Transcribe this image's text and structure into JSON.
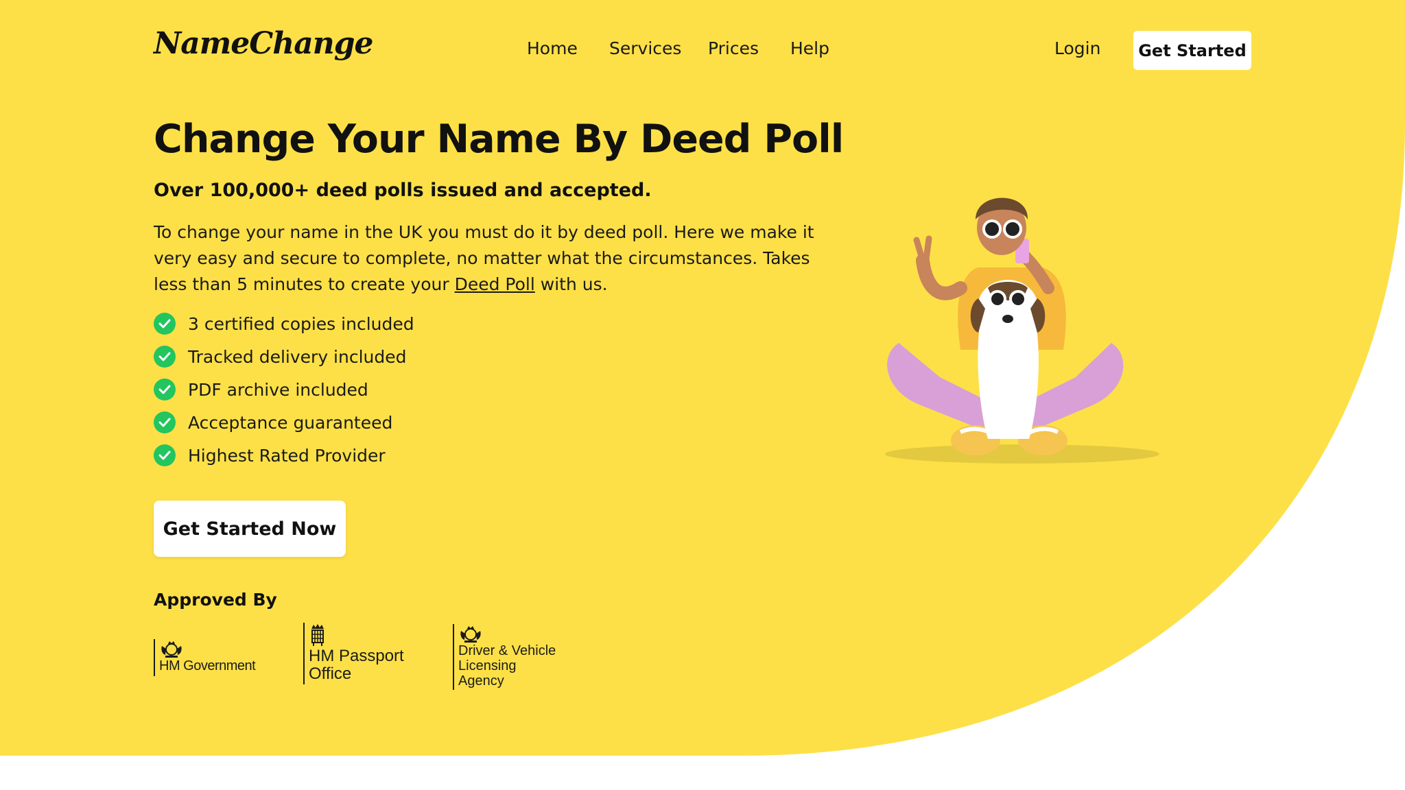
{
  "brand": {
    "logo_text": "NameChange",
    "accent_color": "#FDE047"
  },
  "nav": {
    "items": [
      "Home",
      "Services",
      "Prices",
      "Help"
    ]
  },
  "header": {
    "login_label": "Login",
    "cta_label": "Get Started"
  },
  "hero": {
    "title": "Change Your Name By Deed Poll",
    "subtitle": "Over 100,000+ deed polls issued and accepted.",
    "description_before": "To change your name in the UK you must do it by deed poll. Here we make it very easy and secure to complete, no matter what the circumstances. Takes less than 5 minutes to create your ",
    "description_link": "Deed Poll",
    "description_after": " with us.",
    "features": [
      "3 certified copies included",
      "Tracked delivery included",
      "PDF archive included",
      "Acceptance guaranteed",
      "Highest Rated Provider"
    ],
    "cta_label": "Get Started Now"
  },
  "approved": {
    "title": "Approved By",
    "logos": [
      {
        "lines": [
          "HM Government"
        ],
        "icon": "royal-coat-of-arms-icon"
      },
      {
        "lines": [
          "HM Passport",
          "Office"
        ],
        "icon": "crown-portcullis-icon"
      },
      {
        "lines": [
          "Driver & Vehicle",
          "Licensing",
          "Agency"
        ],
        "icon": "royal-coat-of-arms-icon"
      }
    ]
  },
  "illustration": {
    "subject": "person-with-dog-illustration"
  }
}
